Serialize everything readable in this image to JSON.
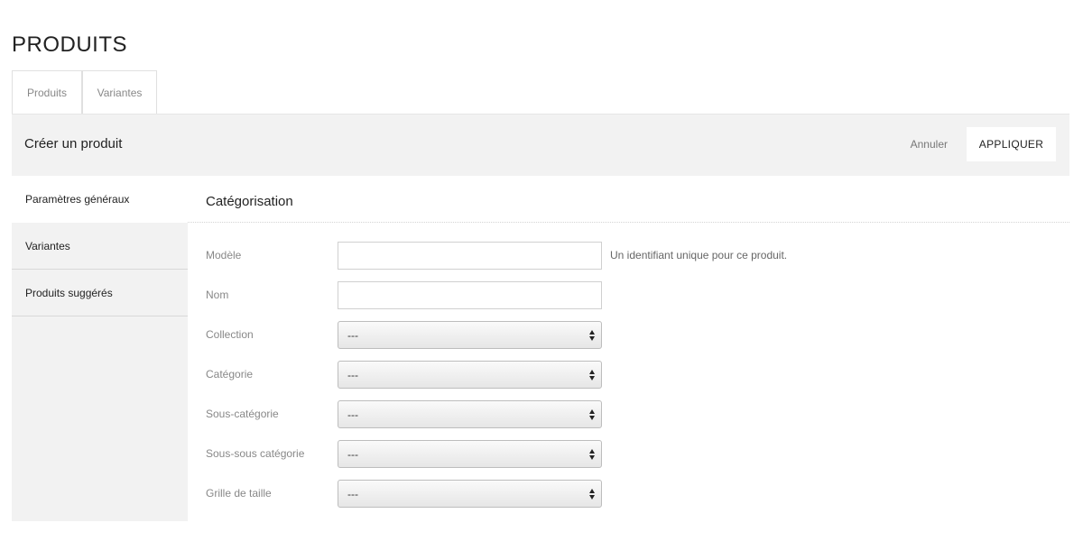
{
  "page": {
    "title": "PRODUITS"
  },
  "tabs": [
    {
      "label": "Produits"
    },
    {
      "label": "Variantes"
    }
  ],
  "header": {
    "title": "Créer un produit",
    "cancel_label": "Annuler",
    "apply_label": "APPLIQUER"
  },
  "sidebar": {
    "items": [
      {
        "label": "Paramètres généraux",
        "active": true
      },
      {
        "label": "Variantes"
      },
      {
        "label": "Produits suggérés"
      }
    ]
  },
  "section": {
    "title": "Catégorisation"
  },
  "form": {
    "modele": {
      "label": "Modèle",
      "value": "",
      "help": "Un identifiant unique pour ce produit."
    },
    "nom": {
      "label": "Nom",
      "value": ""
    },
    "collection": {
      "label": "Collection",
      "value": "---"
    },
    "categorie": {
      "label": "Catégorie",
      "value": "---"
    },
    "sous_categorie": {
      "label": "Sous-catégorie",
      "value": "---"
    },
    "sous_sous_categorie": {
      "label": "Sous-sous catégorie",
      "value": "---"
    },
    "grille_de_taille": {
      "label": "Grille de taille",
      "value": "---"
    }
  },
  "icons": {
    "select_arrow": "up-down-arrows-icon"
  },
  "colors": {
    "panel_bg": "#f2f2f2",
    "border": "#e0e0e0",
    "label": "#888888"
  }
}
